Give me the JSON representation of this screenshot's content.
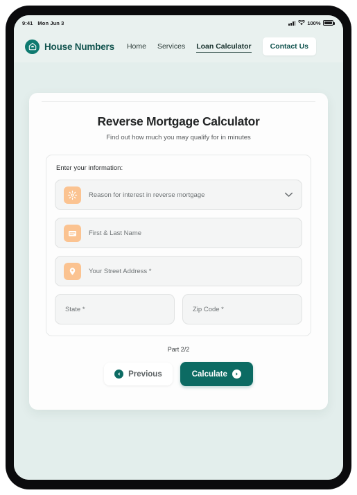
{
  "status_bar": {
    "time": "9:41",
    "date": "Mon Jun 3",
    "battery_percent": "100%",
    "signal_icon": "cellular-signal-icon",
    "wifi_icon": "wifi-icon",
    "battery_icon": "battery-icon"
  },
  "navbar": {
    "logo_icon": "house-logo-icon",
    "brand": "House Numbers",
    "links": [
      {
        "label": "Home",
        "active": false
      },
      {
        "label": "Services",
        "active": false
      },
      {
        "label": "Loan Calculator",
        "active": true
      }
    ],
    "contact_button": "Contact Us"
  },
  "card": {
    "title": "Reverse Mortgage Calculator",
    "subtitle": "Find out how much you may qualify for in minutes"
  },
  "form": {
    "legend": "Enter your information:",
    "reason_field": {
      "label": "Reason for interest in reverse mortgage",
      "icon": "sun-burst-icon",
      "chevron": "chevron-down-icon"
    },
    "name_field": {
      "label": "First & Last Name",
      "icon": "id-card-icon"
    },
    "address_field": {
      "label": "Your Street Address *",
      "icon": "map-pin-icon"
    },
    "state_field": {
      "label": "State *"
    },
    "zip_field": {
      "label": "Zip Code *"
    }
  },
  "footer": {
    "part_label": "Part 2/2",
    "previous_button": "Previous",
    "previous_icon": "arrow-left-circle-icon",
    "calculate_button": "Calculate",
    "calculate_icon": "arrow-right-circle-icon"
  },
  "colors": {
    "brand_teal": "#0e7a70",
    "button_teal": "#0c6b63",
    "page_background": "#e3eeec",
    "nav_background": "#e9f1ef",
    "icon_peach": "#fbc391"
  }
}
